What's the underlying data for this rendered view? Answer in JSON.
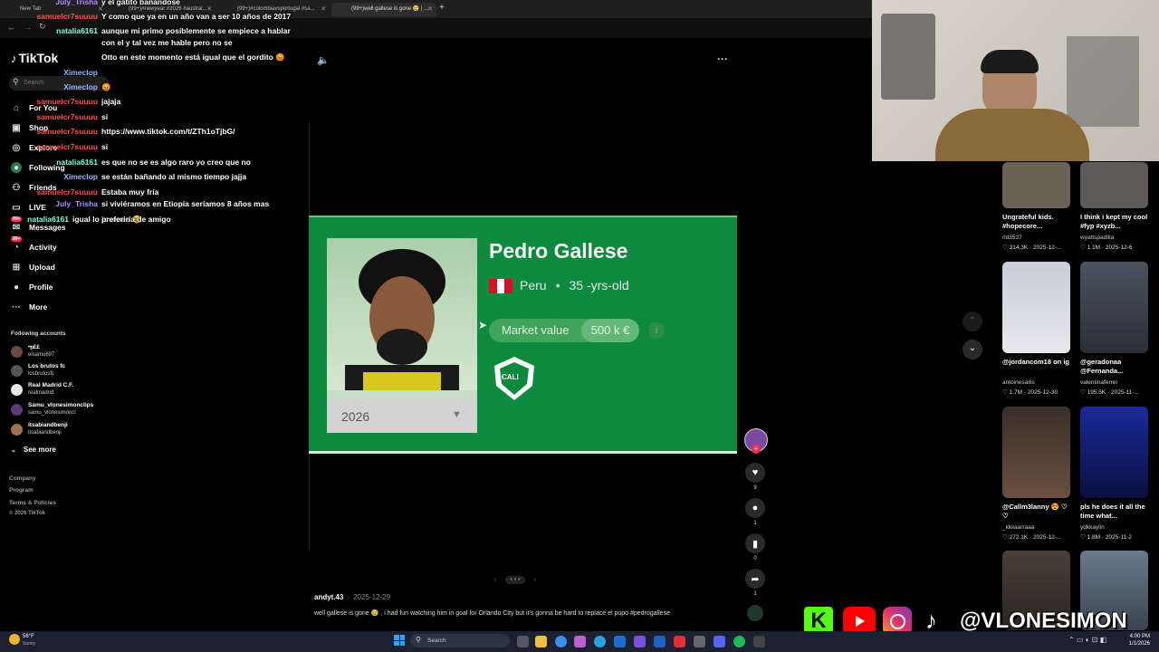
{
  "browser": {
    "tabs": [
      {
        "label": "New Tab"
      },
      {
        "label": "(99+)#newyear #2026 #austral..."
      },
      {
        "label": "(99+)#colombiavsportugal #sa..."
      },
      {
        "label": "(99+)well gallese is gone 😢 | ..."
      }
    ],
    "new_tab_label": "+"
  },
  "chat": [
    {
      "user": "July_Trisha",
      "text": "y el gatito bañandose",
      "color": "#b38cff"
    },
    {
      "user": "samuelcr7suuuu",
      "text": "Y como que ya en un año van a ser 10 años de 2017",
      "color": "#ff4f4f"
    },
    {
      "user": "natalia6161",
      "text": "aunque mi primo posiblemente se empiece a hablar",
      "color": "#7fffd4"
    },
    {
      "user": "",
      "text": "con el y tal vez me hable pero no se",
      "color": "#ffffff"
    },
    {
      "user": "",
      "text": "Otto en este momento está igual que el gordito 😡",
      "color": "#ffffff"
    },
    {
      "user": "Ximeclop",
      "text": "",
      "color": "#9ab8ff"
    },
    {
      "user": "Ximeclop",
      "text": "😡",
      "color": "#9ab8ff"
    },
    {
      "user": "samuelcr7suuuu",
      "text": "jajaja",
      "color": "#ff4f4f"
    },
    {
      "user": "samuelcr7suuuu",
      "text": "si",
      "color": "#ff4f4f"
    },
    {
      "user": "samuelcr7suuuu",
      "text": "https://www.tiktok.com/t/ZTh1oTjbG/",
      "color": "#ff4f4f"
    },
    {
      "user": "samuelcr7suuuu",
      "text": "si",
      "color": "#ff4f4f"
    },
    {
      "user": "natalia6161",
      "text": "es que no se es algo raro yo creo que no",
      "color": "#7fffd4"
    },
    {
      "user": "Ximeclop",
      "text": "se están bañando al mismo tiempo jajja",
      "color": "#9ab8ff"
    },
    {
      "user": "samuelcr7suuuu",
      "text": "Estaba muy fría",
      "color": "#ff4f4f"
    },
    {
      "user": "July_Trisha",
      "text": "si viviéramos en Etiopía seríamos 8 años mas",
      "color": "#b38cff"
    },
    {
      "user": "",
      "text": "jovenes 😊",
      "color": "#ffffff"
    },
    {
      "user": "natalia6161",
      "text": "igual lo preferiría de amigo",
      "color": "#7fffd4"
    }
  ],
  "sidebar": {
    "logo": "TikTok",
    "search_placeholder": "Search",
    "nav": [
      {
        "label": "For You",
        "icon": "home-icon"
      },
      {
        "label": "Shop",
        "icon": "shop-icon"
      },
      {
        "label": "Explore",
        "icon": "compass-icon"
      },
      {
        "label": "Following",
        "icon": "following-icon"
      },
      {
        "label": "Friends",
        "icon": "friends-icon"
      },
      {
        "label": "LIVE",
        "icon": "live-icon"
      },
      {
        "label": "Messages",
        "icon": "messages-icon",
        "badge": "99+"
      },
      {
        "label": "Activity",
        "icon": "activity-icon",
        "badge": "99+"
      },
      {
        "label": "Upload",
        "icon": "upload-icon"
      },
      {
        "label": "Profile",
        "icon": "profile-icon"
      },
      {
        "label": "More",
        "icon": "more-icon"
      }
    ],
    "following_title": "Following accounts",
    "following": [
      {
        "name": "ఌ££",
        "handle": "elsamu697",
        "color": "#6a4a3a"
      },
      {
        "name": "Los brutos fc",
        "handle": "losbrutosfc",
        "color": "#555"
      },
      {
        "name": "Real Madrid C.F.",
        "handle": "realmadrid",
        "color": "#e8e8e8"
      },
      {
        "name": "Samu_vlonesimonclips",
        "handle": "samu_vlonesimoncl",
        "color": "#5a3a7a"
      },
      {
        "name": "itsabiandbenji",
        "handle": "itsabiandbenji",
        "color": "#a07050"
      }
    ],
    "see_more": "See more",
    "footer": [
      "Company",
      "Program",
      "Terms & Policies",
      "© 2026 TikTok"
    ]
  },
  "player": {
    "card": {
      "name": "Pedro Gallese",
      "country": "Peru",
      "age": "35 -yrs-old",
      "market_label": "Market value",
      "market_value": "500 k €",
      "year": "2026",
      "club_logo_text": "CALI"
    },
    "pager": "• • •",
    "author": "andyt.43",
    "date": "2025-12-29",
    "caption": "well gallese is gone 😢 , i had fun watching him in goal for Orlando City but it's gonna be hard to replace el pupo #pedrogallese",
    "actions": [
      {
        "icon": "heart-icon",
        "count": "9"
      },
      {
        "icon": "comment-icon",
        "count": "1"
      },
      {
        "icon": "bookmark-icon",
        "count": "0"
      },
      {
        "icon": "share-icon",
        "count": "1"
      }
    ]
  },
  "feed": [
    {
      "caption": "Ungrateful kids. #hopecore...",
      "user": "rld3537",
      "stats": "♡ 314.3K · 2025-12-...",
      "color": "#6b6255"
    },
    {
      "caption": "I think i kept my cool #fyp #xyzb...",
      "user": "wyattspadilla",
      "stats": "♡ 1.1M · 2025-12-6",
      "color": "#5d5a57"
    },
    {
      "caption": "@jordancom18 on ig",
      "user": "antoinesallis",
      "stats": "♡ 1.7M · 2025-12-30",
      "color": "#c9ccd6"
    },
    {
      "caption": "@geradonaa @Fernanda...",
      "user": "valentinaferrer",
      "stats": "♡ 195.5K · 2025-11-...",
      "color": "#4a5360"
    },
    {
      "caption": "@Callm3lanny 😍 ♡ ♡",
      "user": "_kkiiaarraaa",
      "stats": "♡ 272.1K · 2025-12-...",
      "color": "#3a2e28"
    },
    {
      "caption": "pls he does it all the time what...",
      "user": "ydkkaylin",
      "stats": "♡ 1.8M · 2025-11-2",
      "color": "#1a2a9a"
    }
  ],
  "overlay": {
    "handle": "@VLONESIMON"
  },
  "taskbar": {
    "weather_temp": "56°F",
    "weather_desc": "Sunny",
    "search_label": "Search",
    "time": "4:00 PM",
    "date": "1/1/2026"
  }
}
